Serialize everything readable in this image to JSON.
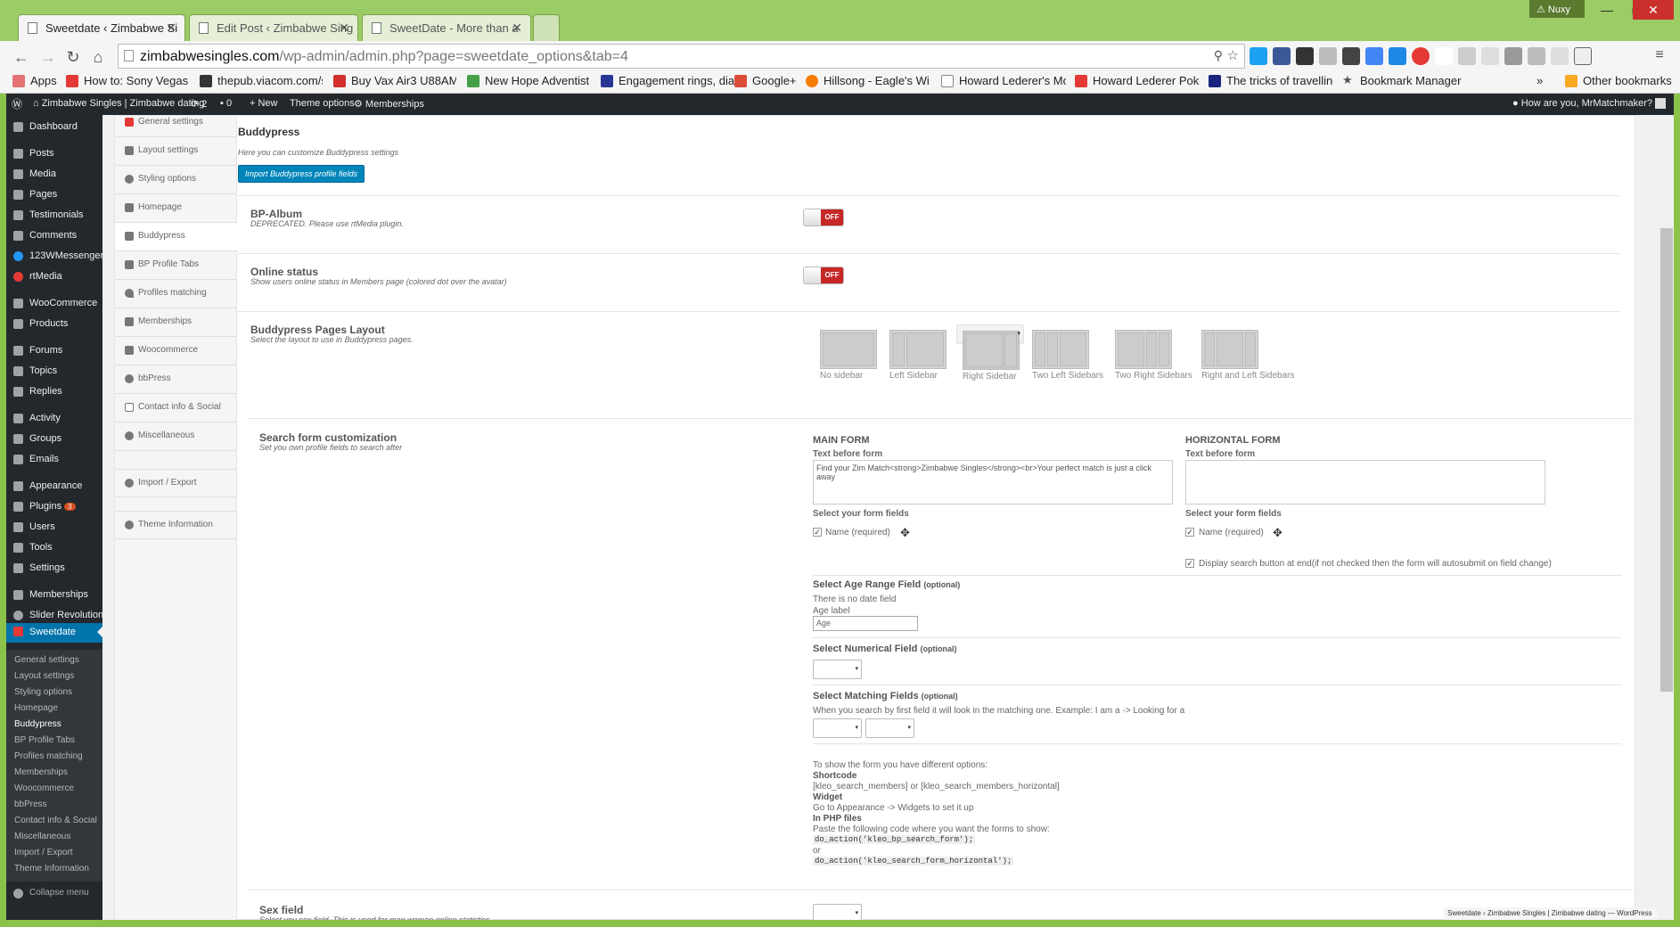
{
  "browser": {
    "tabs": [
      {
        "title": "Sweetdate ‹ Zimbabwe Si"
      },
      {
        "title": "Edit Post ‹ Zimbabwe Sing"
      },
      {
        "title": "SweetDate - More than a"
      }
    ],
    "user": "Nuxy",
    "url_host": "zimbabwesingles.com",
    "url_path": "/wp-admin/admin.php?page=sweetdate_options&tab=4",
    "bookmarks": [
      "Apps",
      "How to: Sony Vegas C",
      "thepub.viacom.com/s",
      "Buy Vax Air3 U88AM",
      "New Hope Adventist C",
      "Engagement rings, dia",
      "Google+",
      "Hillsong - Eagle's Win",
      "Howard Lederer's Mo",
      "Howard Lederer Poke",
      "The tricks of travelling",
      "Bookmark Manager"
    ],
    "other_bookmarks": "Other bookmarks",
    "more": "»"
  },
  "adminbar": {
    "site": "Zimbabwe Singles | Zimbabwe dating",
    "updates": "2",
    "comments": "0",
    "new": "New",
    "theme_options": "Theme options",
    "memberships": "Memberships",
    "howdy": "How are you, MrMatchmaker?"
  },
  "adminmenu": {
    "items": [
      "Dashboard",
      "Posts",
      "Media",
      "Pages",
      "Testimonials",
      "Comments",
      "123WMessenger",
      "rtMedia",
      "WooCommerce",
      "Products",
      "Forums",
      "Topics",
      "Replies",
      "Activity",
      "Groups",
      "Emails",
      "Appearance",
      "Plugins",
      "Users",
      "Tools",
      "Settings",
      "Memberships",
      "Slider Revolution",
      "Sweetdate"
    ],
    "plugins_badge": "3",
    "submenu": [
      "General settings",
      "Layout settings",
      "Styling options",
      "Homepage",
      "Buddypress",
      "BP Profile Tabs",
      "Profiles matching",
      "Memberships",
      "Woocommerce",
      "bbPress",
      "Contact info & Social",
      "Miscellaneous",
      "Import / Export",
      "Theme Information"
    ],
    "collapse": "Collapse menu"
  },
  "option_tabs": [
    "General settings",
    "Layout settings",
    "Styling options",
    "Homepage",
    "Buddypress",
    "BP Profile Tabs",
    "Profiles matching",
    "Memberships",
    "Woocommerce",
    "bbPress",
    "Contact info & Social",
    "Miscellaneous",
    "Import / Export",
    "Theme Information"
  ],
  "section": {
    "title": "Buddypress",
    "desc": "Here you can customize Buddypress settings",
    "import_button": "Import Buddypress profile fields"
  },
  "bp_album": {
    "label": "BP-Album",
    "desc": "DEPRECATED. Please use rtMedia plugin.",
    "state": "OFF"
  },
  "online_status": {
    "label": "Online status",
    "desc": "Show users online status in Members page (colored dot over the avatar)",
    "state": "OFF"
  },
  "pages_layout": {
    "label": "Buddypress Pages Layout",
    "desc": "Select the layout to use in Buddypress pages.",
    "options": [
      "No sidebar",
      "Left Sidebar",
      "Right Sidebar",
      "Two Left Sidebars",
      "Two Right Sidebars",
      "Right and Left Sidebars"
    ],
    "selected": "Right Sidebar"
  },
  "search_form": {
    "label": "Search form customization",
    "desc": "Set you own profile fields to search after",
    "main_title": "MAIN FORM",
    "horizontal_title": "HORIZONTAL FORM",
    "text_before": "Text before form",
    "main_text_value": "Find your Zim Match<strong>Zimbabwe Singles</strong><br>Your perfect match is just a click away",
    "horizontal_text_value": "",
    "select_fields": "Select your form fields",
    "name_required": "Name (required)",
    "display_button": "Display search button at end(if not checked then the form will autosubmit on field change)",
    "age_title": "Select Age Range Field",
    "optional": "(optional)",
    "no_date": "There is no date field",
    "age_label": "Age label",
    "age_value": "Age",
    "numerical_title": "Select Numerical Field",
    "matching_title": "Select Matching Fields",
    "matching_desc": "When you search by first field it will look in the matching one. Example: I am a -> Looking for a",
    "help_intro": "To show the form you have different options:",
    "shortcode_h": "Shortcode",
    "shortcode_v": "[kleo_search_members] or [kleo_search_members_horizontal]",
    "widget_h": "Widget",
    "widget_v": "Go to Appearance -> Widgets to set it up",
    "php_h": "In PHP files",
    "php_v": "Paste the following code where you want the forms to show:",
    "code1": "do_action('kleo_bp_search_form');",
    "or": "or",
    "code2": "do_action('kleo_search_form_horizontal');"
  },
  "sex_field": {
    "label": "Sex field",
    "desc": "Select you sex field. This is used for man woman online statistics"
  },
  "status_bar": "Sweetdate ‹ Zimbabwe Singles | Zimbabwe dating — WordPress"
}
